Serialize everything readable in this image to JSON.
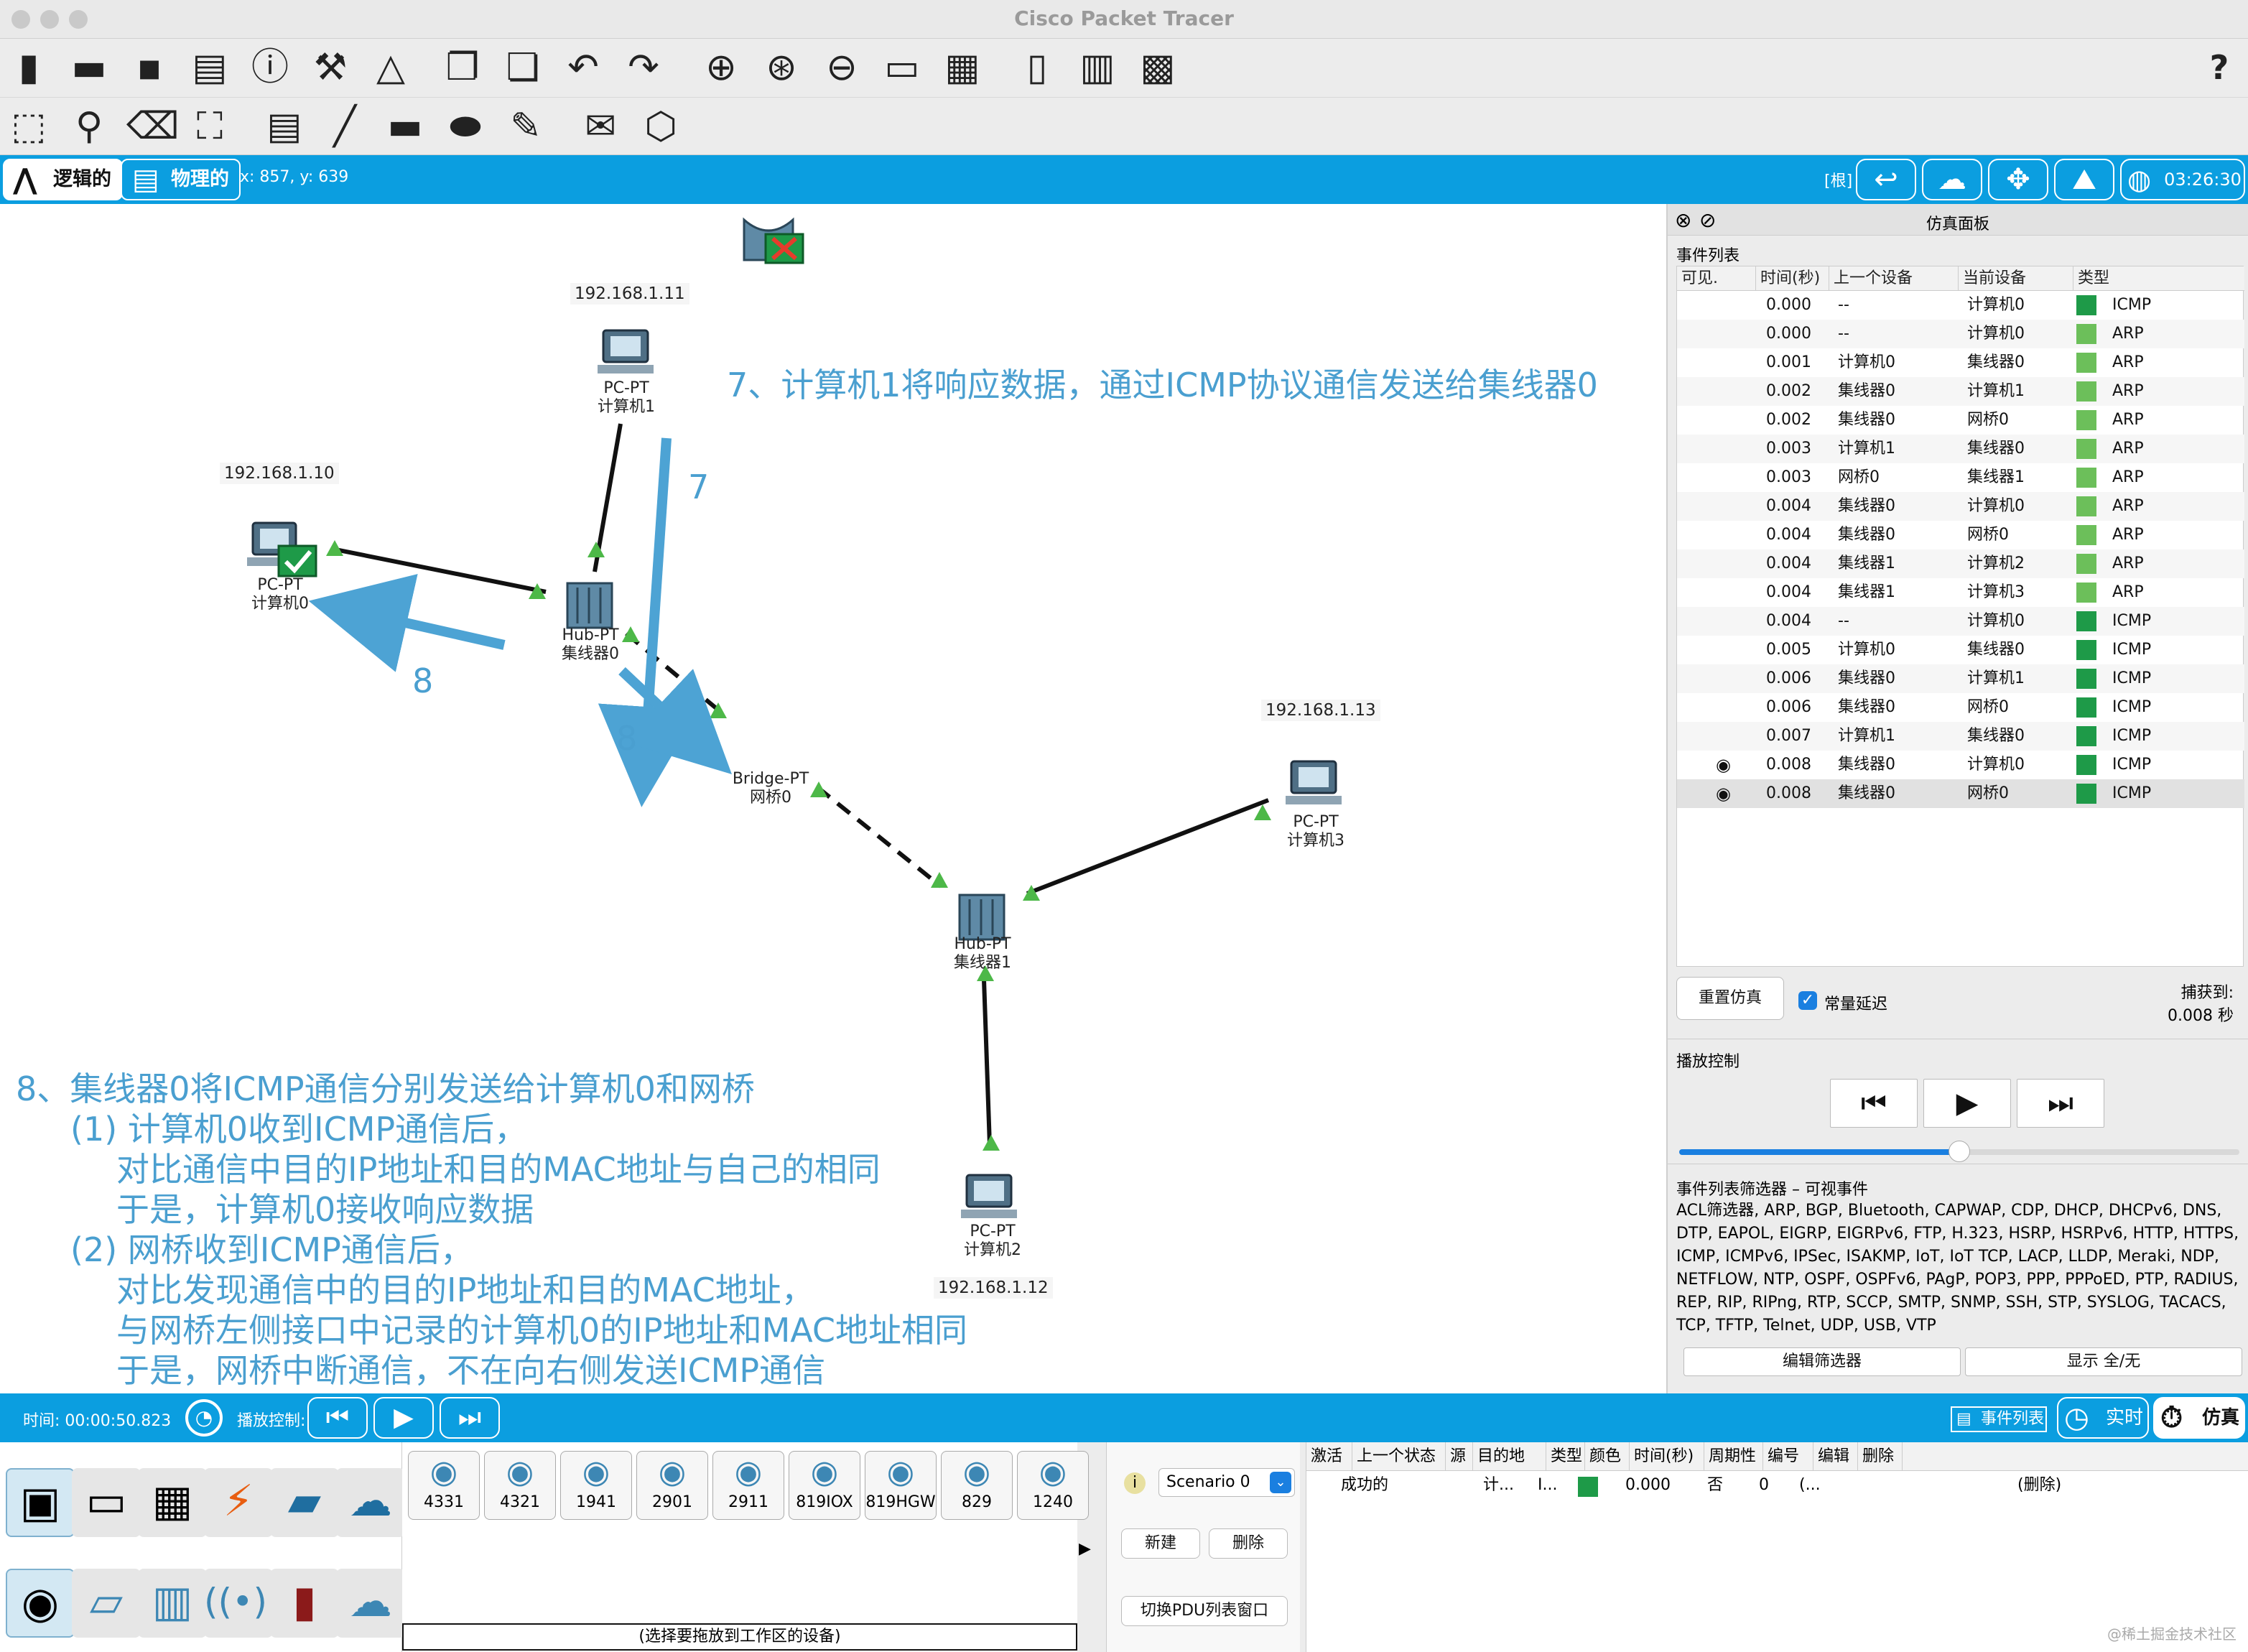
{
  "window": {
    "title": "Cisco Packet Tracer"
  },
  "toolbar": {
    "help": "?"
  },
  "modes": {
    "logical": "逻辑的",
    "physical": "物理的",
    "coords": "x: 857, y: 639",
    "root": "[根]",
    "clock": "03:26:30"
  },
  "devices": [
    {
      "id": "pc0",
      "type": "PC-PT",
      "name": "计算机0",
      "ip": "192.168.1.10"
    },
    {
      "id": "pc1",
      "type": "PC-PT",
      "name": "计算机1",
      "ip": "192.168.1.11"
    },
    {
      "id": "pc2",
      "type": "PC-PT",
      "name": "计算机2",
      "ip": "192.168.1.12"
    },
    {
      "id": "pc3",
      "type": "PC-PT",
      "name": "计算机3",
      "ip": "192.168.1.13"
    },
    {
      "id": "hub0",
      "type": "Hub-PT",
      "name": "集线器0"
    },
    {
      "id": "hub1",
      "type": "Hub-PT",
      "name": "集线器1"
    },
    {
      "id": "bridge0",
      "type": "Bridge-PT",
      "name": "网桥0"
    }
  ],
  "annotations": {
    "step7": "7、计算机1将响应数据，通过ICMP协议通信发送给集线器0",
    "arrow7": "7",
    "arrow8a": "8",
    "arrow8b": "8",
    "step8": [
      "8、集线器0将ICMP通信分别发送给计算机0和网桥",
      "(1) 计算机0收到ICMP通信后，",
      "对比通信中目的IP地址和目的MAC地址与自己的相同",
      "于是，计算机0接收响应数据",
      "(2) 网桥收到ICMP通信后，",
      "对比发现通信中的目的IP地址和目的MAC地址，",
      "与网桥左侧接口中记录的计算机0的IP地址和MAC地址相同",
      "于是，网桥中断通信，不在向右侧发送ICMP通信"
    ]
  },
  "sim_panel": {
    "title": "仿真面板",
    "event_list_label": "事件列表",
    "columns": [
      "可见.",
      "时间(秒)",
      "上一个设备",
      "当前设备",
      "类型"
    ],
    "events": [
      {
        "time": "0.000",
        "prev": "--",
        "cur": "计算机0",
        "type": "ICMP",
        "color": "#1e9a48"
      },
      {
        "time": "0.000",
        "prev": "--",
        "cur": "计算机0",
        "type": "ARP",
        "color": "#6cbf5a"
      },
      {
        "time": "0.001",
        "prev": "计算机0",
        "cur": "集线器0",
        "type": "ARP",
        "color": "#6cbf5a"
      },
      {
        "time": "0.002",
        "prev": "集线器0",
        "cur": "计算机1",
        "type": "ARP",
        "color": "#6cbf5a"
      },
      {
        "time": "0.002",
        "prev": "集线器0",
        "cur": "网桥0",
        "type": "ARP",
        "color": "#6cbf5a"
      },
      {
        "time": "0.003",
        "prev": "计算机1",
        "cur": "集线器0",
        "type": "ARP",
        "color": "#6cbf5a"
      },
      {
        "time": "0.003",
        "prev": "网桥0",
        "cur": "集线器1",
        "type": "ARP",
        "color": "#6cbf5a"
      },
      {
        "time": "0.004",
        "prev": "集线器0",
        "cur": "计算机0",
        "type": "ARP",
        "color": "#6cbf5a"
      },
      {
        "time": "0.004",
        "prev": "集线器0",
        "cur": "网桥0",
        "type": "ARP",
        "color": "#6cbf5a"
      },
      {
        "time": "0.004",
        "prev": "集线器1",
        "cur": "计算机2",
        "type": "ARP",
        "color": "#6cbf5a"
      },
      {
        "time": "0.004",
        "prev": "集线器1",
        "cur": "计算机3",
        "type": "ARP",
        "color": "#6cbf5a"
      },
      {
        "time": "0.004",
        "prev": "--",
        "cur": "计算机0",
        "type": "ICMP",
        "color": "#1e9a48"
      },
      {
        "time": "0.005",
        "prev": "计算机0",
        "cur": "集线器0",
        "type": "ICMP",
        "color": "#1e9a48"
      },
      {
        "time": "0.006",
        "prev": "集线器0",
        "cur": "计算机1",
        "type": "ICMP",
        "color": "#1e9a48"
      },
      {
        "time": "0.006",
        "prev": "集线器0",
        "cur": "网桥0",
        "type": "ICMP",
        "color": "#1e9a48"
      },
      {
        "time": "0.007",
        "prev": "计算机1",
        "cur": "集线器0",
        "type": "ICMP",
        "color": "#1e9a48"
      },
      {
        "time": "0.008",
        "prev": "集线器0",
        "cur": "计算机0",
        "type": "ICMP",
        "color": "#1e9a48",
        "eye": true
      },
      {
        "time": "0.008",
        "prev": "集线器0",
        "cur": "网桥0",
        "type": "ICMP",
        "color": "#1e9a48",
        "eye": true
      }
    ],
    "reset": "重置仿真",
    "const_delay": "常量延迟",
    "captured_label": "捕获到:",
    "captured_value": "0.008 秒",
    "playback_label": "播放控制",
    "slider": 0.5,
    "filter_title": "事件列表筛选器 – 可视事件",
    "filter_text": "ACL筛选器, ARP, BGP, Bluetooth, CAPWAP, CDP, DHCP, DHCPv6, DNS, DTP, EAPOL, EIGRP, EIGRPv6, FTP, H.323, HSRP, HSRPv6, HTTP, HTTPS, ICMP, ICMPv6, IPSec, ISAKMP, IoT, IoT TCP, LACP, LLDP, Meraki, NDP, NETFLOW, NTP, OSPF, OSPFv6, PAgP, POP3, PPP, PPPoED, PTP, RADIUS, REP, RIP, RIPng, RTP, SCCP, SMTP, SNMP, SSH, STP, SYSLOG, TACACS, TCP, TFTP, Telnet, UDP, USB, VTP",
    "edit_filter": "编辑筛选器",
    "show_all": "显示 全/无"
  },
  "bottombar": {
    "time": "时间: 00:00:50.823",
    "playback": "播放控制:",
    "event_list": "事件列表",
    "realtime": "实时",
    "simulation": "仿真"
  },
  "models": [
    "4331",
    "4321",
    "1941",
    "2901",
    "2911",
    "819IOX",
    "819HGW",
    "829",
    "1240"
  ],
  "hint": "(选择要拖放到工作区的设备)",
  "scenario": {
    "name": "Scenario 0",
    "new": "新建",
    "delete": "删除",
    "toggle": "切换PDU列表窗口"
  },
  "pdu": {
    "columns": [
      "激活",
      "上一个状态",
      "源",
      "目的地",
      "类型",
      "颜色",
      "时间(秒)",
      "周期性",
      "编号",
      "编辑",
      "删除"
    ],
    "row": {
      "status": "成功的",
      "src": "计...",
      "dst": "I...",
      "time": "0.000",
      "periodic": "否",
      "num": "0",
      "edit": "(...",
      "del": "(删除)"
    }
  },
  "watermark": "@稀土掘金技术社区"
}
